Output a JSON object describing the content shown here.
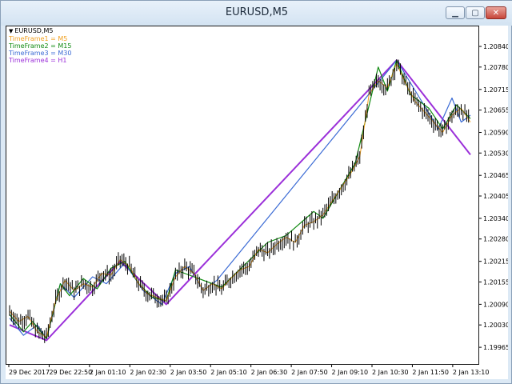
{
  "window": {
    "title": "EURUSD,M5",
    "min_glyph": "▁",
    "max_glyph": "▢",
    "close_glyph": "✕"
  },
  "chart": {
    "symbol_label": "EURUSD,M5",
    "legend": [
      {
        "label": "TimeFrame1 = M5",
        "color": "#f0a020"
      },
      {
        "label": "TimeFrame2 = M15",
        "color": "#128a12"
      },
      {
        "label": "TimeFrame3 = M30",
        "color": "#3a6ad4"
      },
      {
        "label": "TimeFrame4 = H1",
        "color": "#9b30d9"
      }
    ]
  },
  "chart_data": {
    "type": "line",
    "y_ticks": [
      "1.20840",
      "1.20780",
      "1.20715",
      "1.20655",
      "1.20590",
      "1.20530",
      "1.20465",
      "1.20405",
      "1.20340",
      "1.20280",
      "1.20215",
      "1.20155",
      "1.20090",
      "1.20030",
      "1.19965"
    ],
    "x_ticks": [
      "29 Dec 2017",
      "29 Dec 22:50",
      "2 Jan 01:10",
      "2 Jan 02:30",
      "2 Jan 03:50",
      "2 Jan 05:10",
      "2 Jan 06:30",
      "2 Jan 07:50",
      "2 Jan 09:10",
      "2 Jan 10:30",
      "2 Jan 11:50",
      "2 Jan 13:10"
    ],
    "ylim": [
      1.19935,
      1.20875
    ],
    "x_range": [
      0,
      100
    ],
    "series": [
      {
        "name": "TimeFrame4 = H1",
        "color": "#9b30d9",
        "width": 2,
        "points": [
          [
            0,
            1.2003
          ],
          [
            8,
            1.19985
          ],
          [
            24,
            1.20215
          ],
          [
            34,
            1.2009
          ],
          [
            84,
            1.208
          ],
          [
            100,
            1.20525
          ]
        ]
      },
      {
        "name": "TimeFrame3 = M30",
        "color": "#3a6ad4",
        "width": 1.2,
        "points": [
          [
            0,
            1.2005
          ],
          [
            3,
            1.2
          ],
          [
            6,
            1.2003
          ],
          [
            8,
            1.1999
          ],
          [
            11,
            1.2015
          ],
          [
            14,
            1.2011
          ],
          [
            18,
            1.2017
          ],
          [
            21,
            1.2015
          ],
          [
            25,
            1.2021
          ],
          [
            29,
            1.2013
          ],
          [
            33,
            1.2009
          ],
          [
            36,
            1.2018
          ],
          [
            39,
            1.202
          ],
          [
            42,
            1.2013
          ],
          [
            45,
            1.2016
          ],
          [
            84,
            1.208
          ],
          [
            89,
            1.2069
          ],
          [
            93,
            1.206
          ],
          [
            96,
            1.2069
          ],
          [
            98,
            1.2062
          ],
          [
            100,
            1.2064
          ]
        ]
      },
      {
        "name": "TimeFrame2 = M15",
        "color": "#128a12",
        "width": 1.2,
        "points": [
          [
            0,
            1.2006
          ],
          [
            3,
            1.2001
          ],
          [
            5,
            1.2004
          ],
          [
            8,
            1.1999
          ],
          [
            11,
            1.2015
          ],
          [
            13,
            1.20115
          ],
          [
            16,
            1.20165
          ],
          [
            19,
            1.20135
          ],
          [
            22,
            1.20195
          ],
          [
            25,
            1.20215
          ],
          [
            28,
            1.2015
          ],
          [
            31,
            1.2011
          ],
          [
            34,
            1.201
          ],
          [
            36,
            1.2019
          ],
          [
            40,
            1.2017
          ],
          [
            46,
            1.2014
          ],
          [
            56,
            1.2027
          ],
          [
            60,
            1.2029
          ],
          [
            66,
            1.2036
          ],
          [
            68,
            1.2034
          ],
          [
            75,
            1.205
          ],
          [
            80,
            1.2078
          ],
          [
            82,
            1.2071
          ],
          [
            84,
            1.208
          ],
          [
            87,
            1.207
          ],
          [
            91,
            1.2066
          ],
          [
            94,
            1.206
          ],
          [
            97,
            1.2067
          ],
          [
            100,
            1.2063
          ]
        ]
      },
      {
        "name": "TimeFrame1 = M5",
        "color": "#f0a020",
        "width": 1,
        "points": [
          [
            0,
            1.2007
          ],
          [
            2,
            1.2004
          ],
          [
            4,
            1.20055
          ],
          [
            6,
            1.2001
          ],
          [
            8,
            1.19995
          ],
          [
            10,
            1.201
          ],
          [
            12,
            1.2016
          ],
          [
            14,
            1.2013
          ],
          [
            16,
            1.2015
          ],
          [
            18,
            1.2014
          ],
          [
            20,
            1.2018
          ],
          [
            22,
            1.20175
          ],
          [
            24,
            1.2022
          ],
          [
            26,
            1.202
          ],
          [
            28,
            1.2015
          ],
          [
            30,
            1.2012
          ],
          [
            32,
            1.2011
          ],
          [
            34,
            1.201
          ],
          [
            36,
            1.2017
          ],
          [
            38,
            1.202
          ],
          [
            40,
            1.2018
          ],
          [
            42,
            1.2013
          ],
          [
            44,
            1.2015
          ],
          [
            46,
            1.20135
          ],
          [
            48,
            1.20165
          ],
          [
            50,
            1.2019
          ],
          [
            52,
            1.202
          ],
          [
            54,
            1.2025
          ],
          [
            56,
            1.2024
          ],
          [
            58,
            1.20265
          ],
          [
            60,
            1.20285
          ],
          [
            62,
            1.2027
          ],
          [
            64,
            1.2032
          ],
          [
            66,
            1.2033
          ],
          [
            68,
            1.2035
          ],
          [
            70,
            1.2039
          ],
          [
            72,
            1.2043
          ],
          [
            74,
            1.2047
          ],
          [
            76,
            1.2052
          ],
          [
            78,
            1.207
          ],
          [
            80,
            1.2074
          ],
          [
            82,
            1.2072
          ],
          [
            84,
            1.2079
          ],
          [
            86,
            1.2073
          ],
          [
            88,
            1.2068
          ],
          [
            90,
            1.2065
          ],
          [
            92,
            1.2062
          ],
          [
            94,
            1.2059
          ],
          [
            96,
            1.2064
          ],
          [
            98,
            1.2066
          ],
          [
            100,
            1.2062
          ]
        ]
      }
    ]
  }
}
